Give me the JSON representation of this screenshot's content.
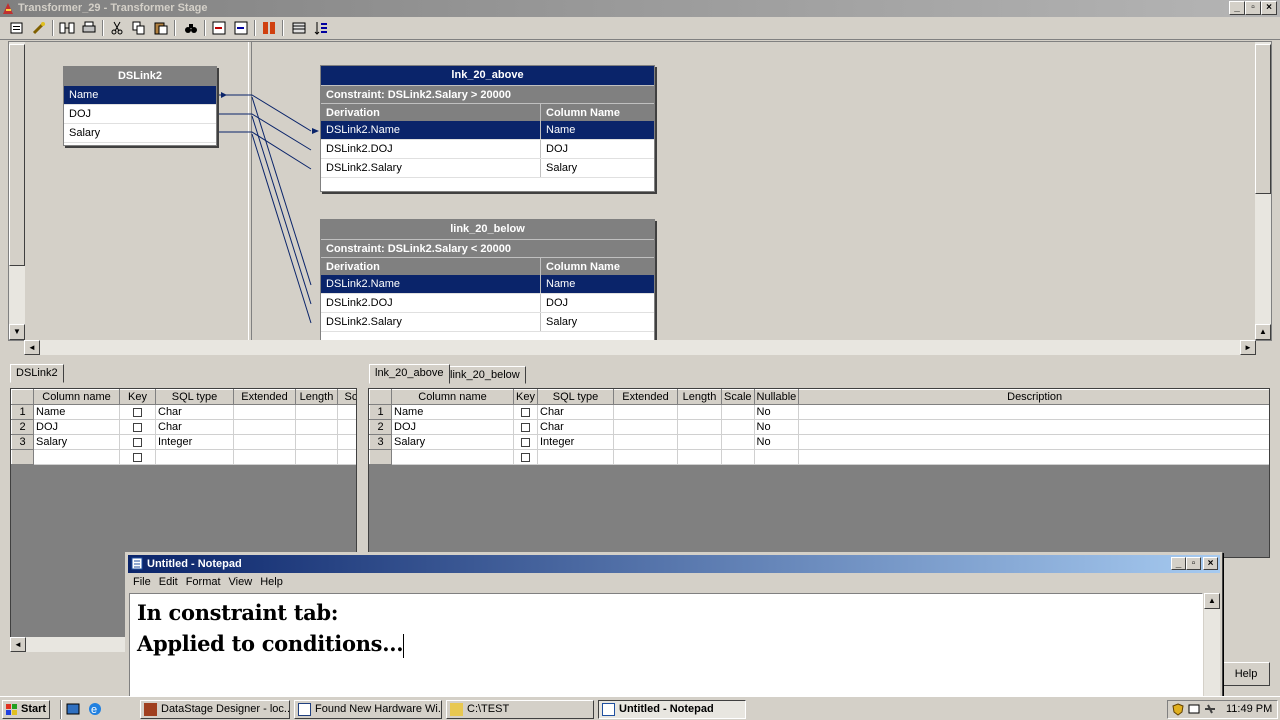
{
  "window": {
    "title": "Transformer_29 - Transformer Stage",
    "min": "_",
    "restore": "▫",
    "close": "×"
  },
  "toolbar": {
    "icons": [
      "properties-icon",
      "links-icon",
      "layout-icon",
      "print-icon",
      "cut-icon",
      "copy-icon",
      "paste-icon",
      "find-icon",
      "input-link-icon",
      "output-link-icon",
      "constraints-icon",
      "columns-icon",
      "sort-icon"
    ]
  },
  "source_link": {
    "name": "DSLink2",
    "columns": [
      "Name",
      "DOJ",
      "Salary"
    ]
  },
  "output_links": [
    {
      "name": "lnk_20_above",
      "constraint": "Constraint: DSLink2.Salary > 20000",
      "h_derivation": "Derivation",
      "h_column": "Column Name",
      "rows": [
        {
          "d": "DSLink2.Name",
          "c": "Name"
        },
        {
          "d": "DSLink2.DOJ",
          "c": "DOJ"
        },
        {
          "d": "DSLink2.Salary",
          "c": "Salary"
        }
      ]
    },
    {
      "name": "link_20_below",
      "constraint": "Constraint: DSLink2.Salary < 20000",
      "h_derivation": "Derivation",
      "h_column": "Column Name",
      "rows": [
        {
          "d": "DSLink2.Name",
          "c": "Name"
        },
        {
          "d": "DSLink2.DOJ",
          "c": "DOJ"
        },
        {
          "d": "DSLink2.Salary",
          "c": "Salary"
        }
      ]
    }
  ],
  "left_grid": {
    "tab": "DSLink2",
    "headers": [
      "Column name",
      "Key",
      "SQL type",
      "Extended",
      "Length",
      "Sca"
    ],
    "rows": [
      {
        "n": "1",
        "name": "Name",
        "type": "Char"
      },
      {
        "n": "2",
        "name": "DOJ",
        "type": "Char"
      },
      {
        "n": "3",
        "name": "Salary",
        "type": "Integer"
      }
    ]
  },
  "right_grid": {
    "tabs": [
      "lnk_20_above",
      "link_20_below"
    ],
    "headers": [
      "Column name",
      "Key",
      "SQL type",
      "Extended",
      "Length",
      "Scale",
      "Nullable",
      "Description"
    ],
    "rows": [
      {
        "n": "1",
        "name": "Name",
        "type": "Char",
        "nullable": "No"
      },
      {
        "n": "2",
        "name": "DOJ",
        "type": "Char",
        "nullable": "No"
      },
      {
        "n": "3",
        "name": "Salary",
        "type": "Integer",
        "nullable": "No"
      }
    ]
  },
  "notepad": {
    "title": "Untitled - Notepad",
    "menu": [
      "File",
      "Edit",
      "Format",
      "View",
      "Help"
    ],
    "line1": "In constraint tab:",
    "line2": "Applied to conditions..."
  },
  "help_button": "Help",
  "taskbar": {
    "start": "Start",
    "items": [
      "DataStage Designer - loc...",
      "Found New Hardware Wi...",
      "C:\\TEST",
      "Untitled - Notepad"
    ],
    "clock": "11:49 PM"
  }
}
